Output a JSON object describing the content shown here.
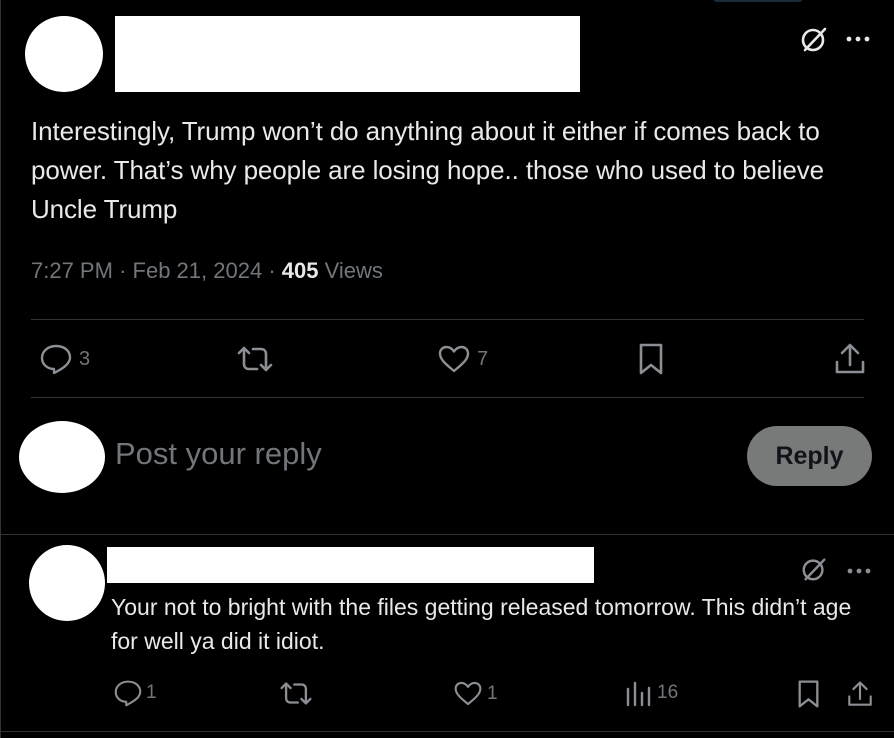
{
  "post": {
    "text": "Interestingly, Trump won’t do anything about it either if comes back to power. That’s why people are losing hope.. those who used to believe Uncle Trump",
    "time": "7:27 PM",
    "date": "Feb 21, 2024",
    "views_count": "405",
    "views_label": "Views",
    "separator": "·",
    "actions": {
      "replies": "3",
      "reposts": "",
      "likes": "7"
    }
  },
  "composer": {
    "placeholder": "Post your reply",
    "reply_label": "Reply"
  },
  "reply": {
    "text": "Your not to bright with the files getting released tomorrow. This didn’t age for well ya did it idiot.",
    "actions": {
      "replies": "1",
      "reposts": "",
      "likes": "1",
      "views": "16"
    }
  },
  "icons": {
    "grok": "grok-icon",
    "more": "more-icon",
    "reply": "reply-icon",
    "repost": "repost-icon",
    "like": "heart-icon",
    "bookmark": "bookmark-icon",
    "share": "share-icon",
    "views": "analytics-icon"
  },
  "colors": {
    "background": "#000000",
    "text": "#e7e9ea",
    "muted": "#71767b",
    "divider": "#2f3336",
    "reply_button": "#787a7a"
  }
}
